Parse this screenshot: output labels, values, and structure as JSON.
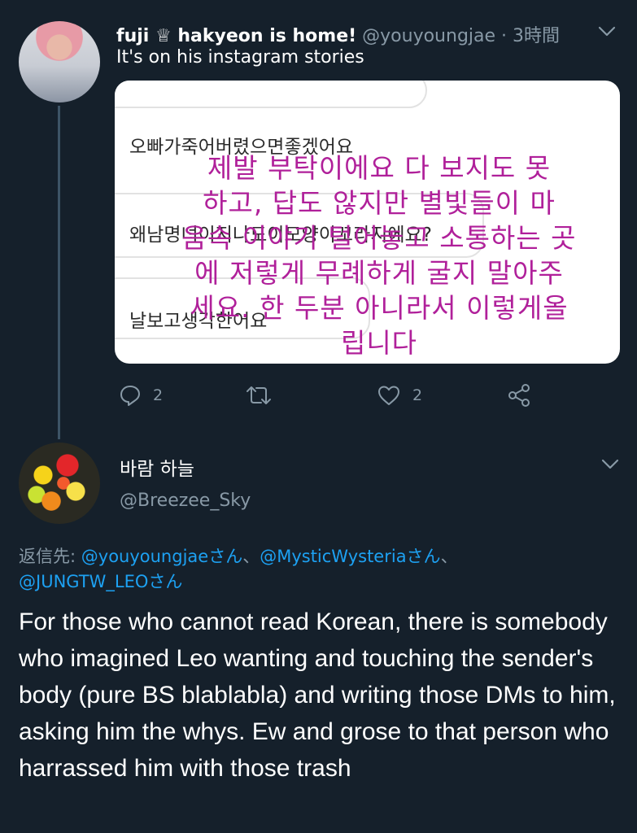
{
  "tweet1": {
    "display_name": "fuji ♕ hakyeon is home!",
    "handle": "@youyoungjae",
    "separator": " · ",
    "time": "3時間",
    "text": "It's on his instagram stories",
    "media": {
      "dm_line_1": "오빠가죽어버렸으면좋겠어요",
      "dm_line_2": "왜남명녀이지나도이모양이꼬라지에요?",
      "dm_line_3": "날보고생각한어요",
      "overlay_lines": [
        "제발 부탁이에요 다 보지도 못",
        "하고, 답도 않지만  별빛들이  마",
        "음속 이야기 털어놓고 소통하는 곳",
        "에 저렇게 무례하게 굴지 말아주",
        "세요. 한 두분 아니라서 이렇게올",
        "립니다"
      ]
    },
    "actions": {
      "reply_count": "2",
      "retweet_count": "",
      "like_count": "2"
    }
  },
  "tweet2": {
    "display_name": "바람 하늘",
    "handle": "@Breezee_Sky",
    "reply_prefix": "返信先: ",
    "mentions": [
      "@youyoungjaeさん",
      "@MysticWysteriaさん",
      "@JUNGTW_LEOさん"
    ],
    "mention_separator": "、",
    "text": "For those who cannot read Korean, there is somebody who imagined Leo wanting and touching the sender's body (pure BS blablabla) and writing those DMs to him, asking him the whys. Ew and grose to that person who harrassed him with those trash"
  },
  "icons": {
    "reply": "reply-icon",
    "retweet": "retweet-icon",
    "like": "heart-icon",
    "share": "share-icon",
    "menu": "chevron-down-icon"
  },
  "colors": {
    "background": "#15202b",
    "secondary_text": "#8899a6",
    "mention": "#1da1f2",
    "overlay_text": "#b0209a"
  }
}
